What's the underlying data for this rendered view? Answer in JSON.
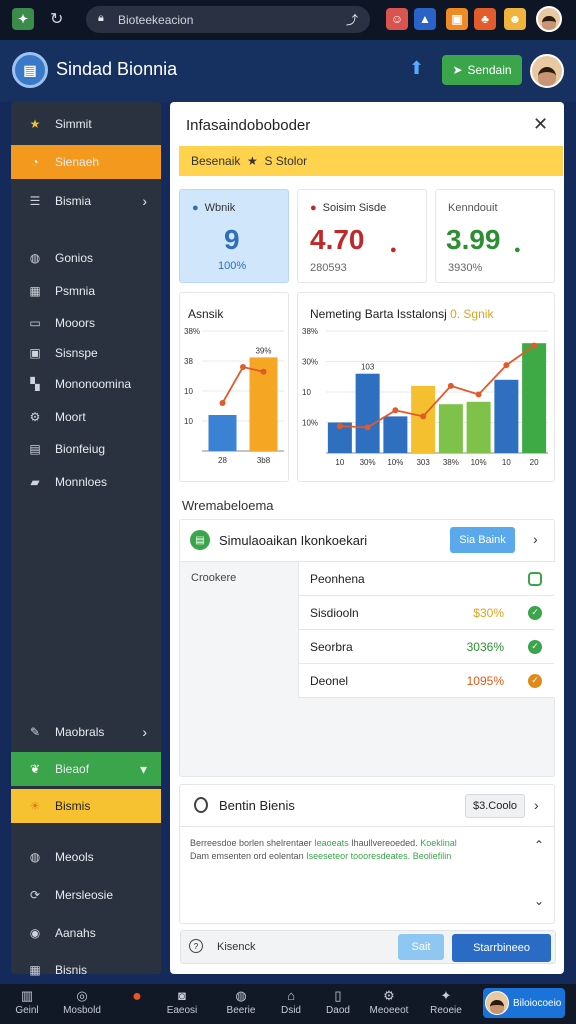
{
  "browser": {
    "url": "Bioteekeacion",
    "lock": "lock-icon"
  },
  "header": {
    "title": "Sindad Bionnia",
    "action_label": "Sendain"
  },
  "sidebar": {
    "items": [
      {
        "label": "Simmit",
        "icon": "star-icon",
        "color": "#f2c230"
      },
      {
        "label": "Sienaeh",
        "icon": "clock-icon",
        "color": "#f39a1e",
        "active": "orange"
      },
      {
        "label": "Bismia",
        "icon": "list-icon",
        "chevron": true
      },
      {
        "label": "Gonios",
        "icon": "globe-icon"
      },
      {
        "label": "Psmnia",
        "icon": "calendar-icon"
      },
      {
        "label": "Mooors",
        "icon": "monitor-icon"
      },
      {
        "label": "Sisnspe",
        "icon": "image-icon"
      },
      {
        "label": "Mononoomina",
        "icon": "grid-icon"
      },
      {
        "label": "Moort",
        "icon": "gear-icon"
      },
      {
        "label": "Bionfeiug",
        "icon": "table-icon"
      },
      {
        "label": "Monnloes",
        "icon": "folder-icon"
      },
      {
        "label": "Maobrals",
        "icon": "wrench-icon",
        "chevron": true
      },
      {
        "label": "Bieaof",
        "icon": "leaf-icon",
        "active": "green",
        "caret": true
      },
      {
        "label": "Bismis",
        "icon": "sun-icon",
        "active": "yellow"
      },
      {
        "label": "Meools",
        "icon": "globe-icon"
      },
      {
        "label": "Mersleosie",
        "icon": "refresh-icon"
      },
      {
        "label": "Aanahs",
        "icon": "chrome-icon"
      },
      {
        "label": "Bisnis",
        "icon": "calendar-icon"
      }
    ]
  },
  "panel": {
    "title": "Infasaindoboboder",
    "banner": "Besenaik  ★  S Stolor"
  },
  "kpis": [
    {
      "label": "Wbnik",
      "value": "9",
      "sub": "100%",
      "color": "#2f6fb8",
      "bg": "#cfe6fb"
    },
    {
      "label": "Soisim Sisde",
      "value": "4.70",
      "sub": "280593",
      "color": "#c0282a"
    },
    {
      "label": "Kenndouit",
      "value": "3.99",
      "sub": "3930%",
      "color": "#2c8f32"
    }
  ],
  "chart_data": [
    {
      "type": "bar",
      "title": "Asnsik",
      "yticks": [
        "38%",
        "38",
        "10",
        "10"
      ],
      "categories": [
        "28",
        "3b8"
      ],
      "values": [
        30,
        78
      ],
      "data_labels": [
        "",
        "39%"
      ],
      "colors": [
        "#3b82d4",
        "#f5a623"
      ],
      "line": [
        40,
        70,
        66
      ],
      "ylim": [
        0,
        100
      ]
    },
    {
      "type": "bar",
      "title": "Nemeting Barta Isstalonsj",
      "title_accent": "0. Sgnik",
      "yticks": [
        "38%",
        "30%",
        "10",
        "10%"
      ],
      "categories": [
        "10",
        "30%",
        "10%",
        "303",
        "38%",
        "10%",
        "10",
        "20"
      ],
      "values": [
        25,
        65,
        30,
        55,
        40,
        42,
        60,
        90
      ],
      "data_labels": [
        "",
        "103",
        "",
        "",
        "",
        "",
        "",
        ""
      ],
      "colors": [
        "#2f6fbf",
        "#2f6fbf",
        "#2f6fbf",
        "#f5c030",
        "#7ec24a",
        "#7ec24a",
        "#2f6fbf",
        "#3daa46"
      ],
      "line": [
        22,
        21,
        35,
        30,
        55,
        48,
        72,
        88
      ],
      "ylim": [
        0,
        100
      ]
    }
  ],
  "section": {
    "label": "Wremabeloema",
    "card_title": "Simulaoaikan Ikonkoekari",
    "card_button": "Sia Baink",
    "col_left": "Crookere",
    "rows": [
      {
        "label": "Peonhena",
        "pct": "",
        "status": "pending",
        "status_color": "#3aa54a"
      },
      {
        "label": "Sisdiooln",
        "pct": "$30%",
        "pct_color": "#e0a21a",
        "status": "check",
        "status_color": "#3aa54a"
      },
      {
        "label": "Seorbra",
        "pct": "3036%",
        "pct_color": "#2c8f32",
        "status": "check",
        "status_color": "#3aa54a"
      },
      {
        "label": "Deonel",
        "pct": "1095%",
        "pct_color": "#e05a1a",
        "status": "check",
        "status_color": "#e08a1a"
      }
    ]
  },
  "section2": {
    "title": "Bentin Bienis",
    "badge": "$3.Coolo",
    "text_line1": "Berreesdoe borlen shelrentaer",
    "text_line1_green": "Ieaoeats",
    "text_line1_b": "Ihaullvereoeded.",
    "text_line1_green2": "Koeklinal",
    "text_line2": "Dam emsenten ord eolentan",
    "text_line2_green": "Iseeseteor toooresdeates.",
    "text_line2_green2": "Beoliefilin"
  },
  "footer": {
    "input_label": "Kisenck",
    "btn1": "Sait",
    "btn2": "Starrbineeo"
  },
  "botnav": [
    {
      "label": "Geinl",
      "icon": "chart-icon"
    },
    {
      "label": "Mosbold",
      "icon": "target-icon"
    },
    {
      "label": "",
      "icon": "record-icon"
    },
    {
      "label": "Eaeosi",
      "icon": "camera-icon"
    },
    {
      "label": "Beerie",
      "icon": "globe-icon"
    },
    {
      "label": "Dsid",
      "icon": "home-icon"
    },
    {
      "label": "Daod",
      "icon": "phone-icon"
    },
    {
      "label": "Meoeeot",
      "icon": "settings-icon"
    },
    {
      "label": "Reoeie",
      "icon": "puzzle-icon"
    }
  ],
  "profile_button": "Biloiocoeio"
}
